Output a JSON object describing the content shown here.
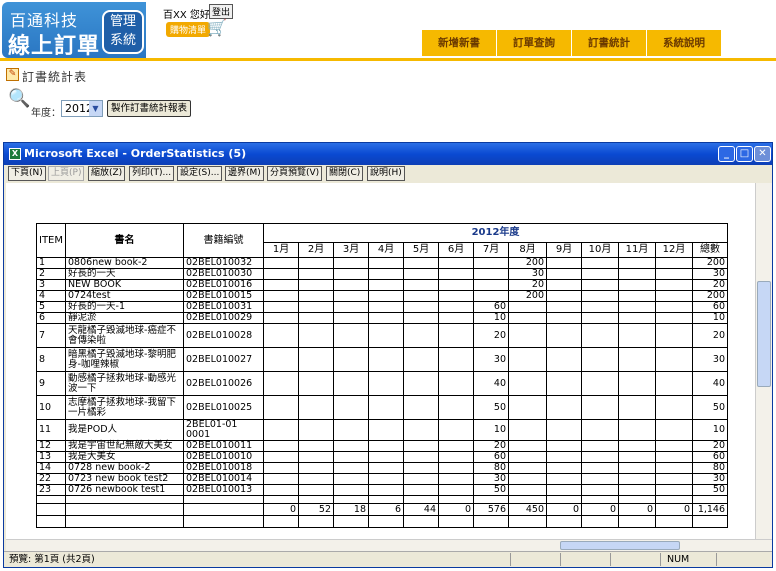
{
  "header": {
    "logo_line1": "百通科技",
    "logo_line2": "線上訂單",
    "logo_badge_line1": "管理",
    "logo_badge_line2": "系統",
    "user_greeting": "百XX 您好",
    "logout_label": "登出",
    "cart_label": "購物清單",
    "nav": [
      "新增新書",
      "訂單查詢",
      "訂書統計",
      "系統說明"
    ]
  },
  "page": {
    "title": "訂書統計表",
    "year_label": "年度：",
    "year_value": "2012",
    "make_report_label": "製作訂書統計報表"
  },
  "window": {
    "title": "Microsoft Excel - OrderStatistics (5)",
    "toolbar": [
      "下頁(N)",
      "上頁(P)",
      "縮放(Z)",
      "列印(T)...",
      "設定(S)...",
      "邊界(M)",
      "分頁預覽(V)",
      "關閉(C)",
      "說明(H)"
    ],
    "status_left": "預覽: 第1頁 (共2頁)",
    "status_num": "NUM"
  },
  "table": {
    "head_item": "ITEM",
    "head_name": "書名",
    "head_code": "書籍編號",
    "year_title": "2012年度",
    "months": [
      "1月",
      "2月",
      "3月",
      "4月",
      "5月",
      "6月",
      "7月",
      "8月",
      "9月",
      "10月",
      "11月",
      "12月",
      "總數"
    ],
    "rows": [
      {
        "item": "1",
        "name": "0806new book-2",
        "code": "02BEL010032",
        "m": [
          "",
          "",
          "",
          "",
          "",
          "",
          "",
          "200",
          "",
          "",
          "",
          "",
          "200"
        ]
      },
      {
        "item": "2",
        "name": "好長的一天",
        "code": "02BEL010030",
        "m": [
          "",
          "",
          "",
          "",
          "",
          "",
          "",
          "30",
          "",
          "",
          "",
          "",
          "30"
        ]
      },
      {
        "item": "3",
        "name": "NEW BOOK",
        "code": "02BEL010016",
        "m": [
          "",
          "",
          "",
          "",
          "",
          "",
          "",
          "20",
          "",
          "",
          "",
          "",
          "20"
        ]
      },
      {
        "item": "4",
        "name": "0724test",
        "code": "02BEL010015",
        "m": [
          "",
          "",
          "",
          "",
          "",
          "",
          "",
          "200",
          "",
          "",
          "",
          "",
          "200"
        ]
      },
      {
        "item": "5",
        "name": "好長的一天-1",
        "code": "02BEL010031",
        "m": [
          "",
          "",
          "",
          "",
          "",
          "",
          "60",
          "",
          "",
          "",
          "",
          "",
          "60"
        ]
      },
      {
        "item": "6",
        "name": "靜泥淤",
        "code": "02BEL010029",
        "m": [
          "",
          "",
          "",
          "",
          "",
          "",
          "10",
          "",
          "",
          "",
          "",
          "",
          "10"
        ]
      },
      {
        "item": "7",
        "name": "天龍橘子毀滅地球-癌症不會傳染啦",
        "code": "02BEL010028",
        "m": [
          "",
          "",
          "",
          "",
          "",
          "",
          "20",
          "",
          "",
          "",
          "",
          "",
          "20"
        ]
      },
      {
        "item": "8",
        "name": "暗黑橘子毀滅地球-黎明肥身-咖哩辣椒",
        "code": "02BEL010027",
        "m": [
          "",
          "",
          "",
          "",
          "",
          "",
          "30",
          "",
          "",
          "",
          "",
          "",
          "30"
        ]
      },
      {
        "item": "9",
        "name": "動感橘子拯救地球-動感光波一下",
        "code": "02BEL010026",
        "m": [
          "",
          "",
          "",
          "",
          "",
          "",
          "40",
          "",
          "",
          "",
          "",
          "",
          "40"
        ]
      },
      {
        "item": "10",
        "name": "志摩橘子拯救地球-我留下一片橘彩",
        "code": "02BEL010025",
        "m": [
          "",
          "",
          "",
          "",
          "",
          "",
          "50",
          "",
          "",
          "",
          "",
          "",
          "50"
        ]
      },
      {
        "item": "11",
        "name": "我是POD人",
        "code": "2BEL01-01 0001",
        "m": [
          "",
          "",
          "",
          "",
          "",
          "",
          "10",
          "",
          "",
          "",
          "",
          "",
          "10"
        ]
      },
      {
        "item": "12",
        "name": "我是宇宙世紀無敵大美女",
        "code": "02BEL010011",
        "m": [
          "",
          "",
          "",
          "",
          "",
          "",
          "20",
          "",
          "",
          "",
          "",
          "",
          "20"
        ]
      },
      {
        "item": "13",
        "name": "我是大美女",
        "code": "02BEL010010",
        "m": [
          "",
          "",
          "",
          "",
          "",
          "",
          "60",
          "",
          "",
          "",
          "",
          "",
          "60"
        ]
      },
      {
        "item": "14",
        "name": "0728 new book-2",
        "code": "02BEL010018",
        "m": [
          "",
          "",
          "",
          "",
          "",
          "",
          "80",
          "",
          "",
          "",
          "",
          "",
          "80"
        ]
      },
      {
        "item": "22",
        "name": "0723 new book test2",
        "code": "02BEL010014",
        "m": [
          "",
          "",
          "",
          "",
          "",
          "",
          "30",
          "",
          "",
          "",
          "",
          "",
          "30"
        ]
      },
      {
        "item": "23",
        "name": "0726 newbook test1",
        "code": "02BEL010013",
        "m": [
          "",
          "",
          "",
          "",
          "",
          "",
          "50",
          "",
          "",
          "",
          "",
          "",
          "50"
        ]
      }
    ],
    "totals": [
      "0",
      "52",
      "18",
      "6",
      "44",
      "0",
      "576",
      "450",
      "0",
      "0",
      "0",
      "0",
      "1,146"
    ]
  }
}
